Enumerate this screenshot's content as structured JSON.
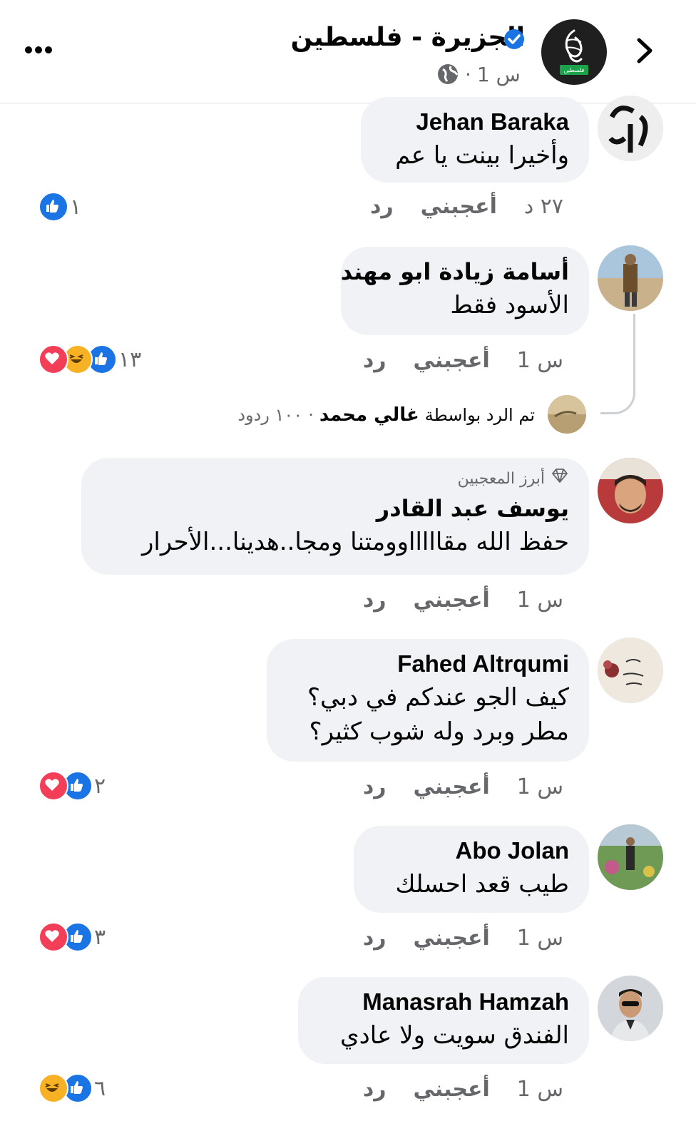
{
  "header": {
    "page_name": "الجزيرة  -  فلسطين",
    "time": "1 س",
    "separator": "·",
    "avatar_label": "فلسطين",
    "icons": {
      "back": "chevron-right-icon",
      "more": "more-dots-icon",
      "verified": "verified-badge-icon",
      "audience": "globe-icon"
    }
  },
  "comments": [
    {
      "name": "Jehan Baraka",
      "text": "وأخيرا بينت يا عم",
      "time": "٢٧ د",
      "like": "أعجبني",
      "reply": "رد",
      "reaction_count": "١",
      "reactions": [
        "like"
      ]
    },
    {
      "name": "أسامة زيادة ابو مهند",
      "text": "الأسود فقط",
      "time": "1 س",
      "like": "أعجبني",
      "reply": "رد",
      "reaction_count": "١٣",
      "reactions": [
        "like",
        "haha",
        "love"
      ],
      "replies_summary": {
        "prefix": "تم الرد بواسطة",
        "replier": "غالي محمد",
        "separator": "·",
        "count": "١٠٠ ردود"
      }
    },
    {
      "badge": "أبرز المعجبين",
      "name": "يوسف عبد القادر",
      "text": "حفظ الله مقاااااوومتنا ومجا..هدينا...الأحرار",
      "time": "1 س",
      "like": "أعجبني",
      "reply": "رد"
    },
    {
      "name": "Fahed Altrqumi",
      "text_line1": "كيف الجو عندكم في دبي؟",
      "text_line2": "مطر وبرد  وله شوب كثير؟",
      "time": "1 س",
      "like": "أعجبني",
      "reply": "رد",
      "reaction_count": "٢",
      "reactions": [
        "like",
        "love"
      ]
    },
    {
      "name": "Abo Jolan",
      "text": "طيب قعد احسلك",
      "time": "1 س",
      "like": "أعجبني",
      "reply": "رد",
      "reaction_count": "٣",
      "reactions": [
        "like",
        "love"
      ]
    },
    {
      "name": "Manasrah Hamzah",
      "text": "الفندق سويت ولا عادي",
      "time": "1 س",
      "like": "أعجبني",
      "reply": "رد",
      "reaction_count": "٦",
      "reactions": [
        "like",
        "haha"
      ]
    }
  ],
  "colors": {
    "bubble": "#f0f2f5",
    "muted": "#65676b",
    "like": "#1b74e4",
    "love": "#f33e58",
    "haha": "#f7b125",
    "verified": "#1b74e4"
  }
}
